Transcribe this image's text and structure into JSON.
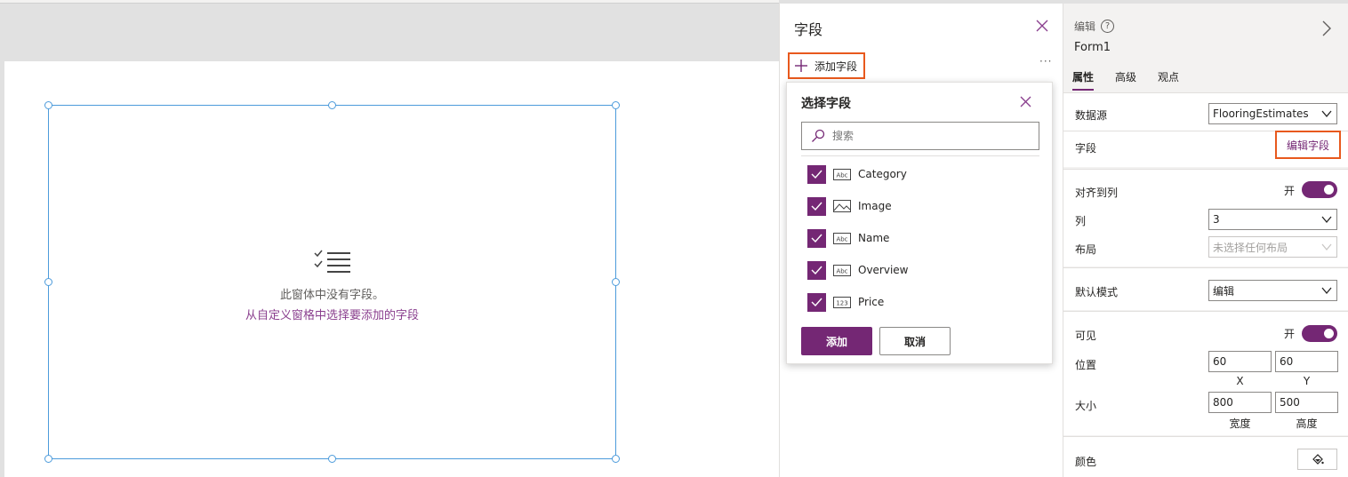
{
  "canvas": {
    "empty_message": "此窗体中没有字段。",
    "empty_hint": "从自定义窗格中选择要添加的字段"
  },
  "fields_panel": {
    "title": "字段",
    "add_field_label": "添加字段",
    "more_label": "···"
  },
  "choose_field_popup": {
    "title": "选择字段",
    "search_placeholder": "搜索",
    "items": [
      {
        "label": "Category",
        "type_icon": "text-abc-icon",
        "checked": true
      },
      {
        "label": "Image",
        "type_icon": "image-icon",
        "checked": true
      },
      {
        "label": "Name",
        "type_icon": "text-abc-icon",
        "checked": true
      },
      {
        "label": "Overview",
        "type_icon": "text-abc-icon",
        "checked": true
      },
      {
        "label": "Price",
        "type_icon": "number-123-icon",
        "checked": true
      }
    ],
    "add_button": "添加",
    "cancel_button": "取消"
  },
  "properties": {
    "type_label": "编辑",
    "control_name": "Form1",
    "tabs": [
      "属性",
      "高级",
      "观点"
    ],
    "active_tab": "属性",
    "data_source_label": "数据源",
    "data_source_value": "FlooringEstimates",
    "fields_label": "字段",
    "edit_fields_button": "编辑字段",
    "snap_to_columns_label": "对齐到列",
    "snap_to_columns_state": "开",
    "columns_label": "列",
    "columns_value": "3",
    "layout_label": "布局",
    "layout_value": "未选择任何布局",
    "default_mode_label": "默认模式",
    "default_mode_value": "编辑",
    "visible_label": "可见",
    "visible_state": "开",
    "position_label": "位置",
    "x_value": "60",
    "y_value": "60",
    "x_label": "X",
    "y_label": "Y",
    "size_label": "大小",
    "width_value": "800",
    "height_value": "500",
    "width_label": "宽度",
    "height_label": "高度",
    "color_label": "颜色"
  },
  "colors": {
    "accent": "#742774",
    "highlight": "#e8591d",
    "selection": "#4c9bdb"
  }
}
